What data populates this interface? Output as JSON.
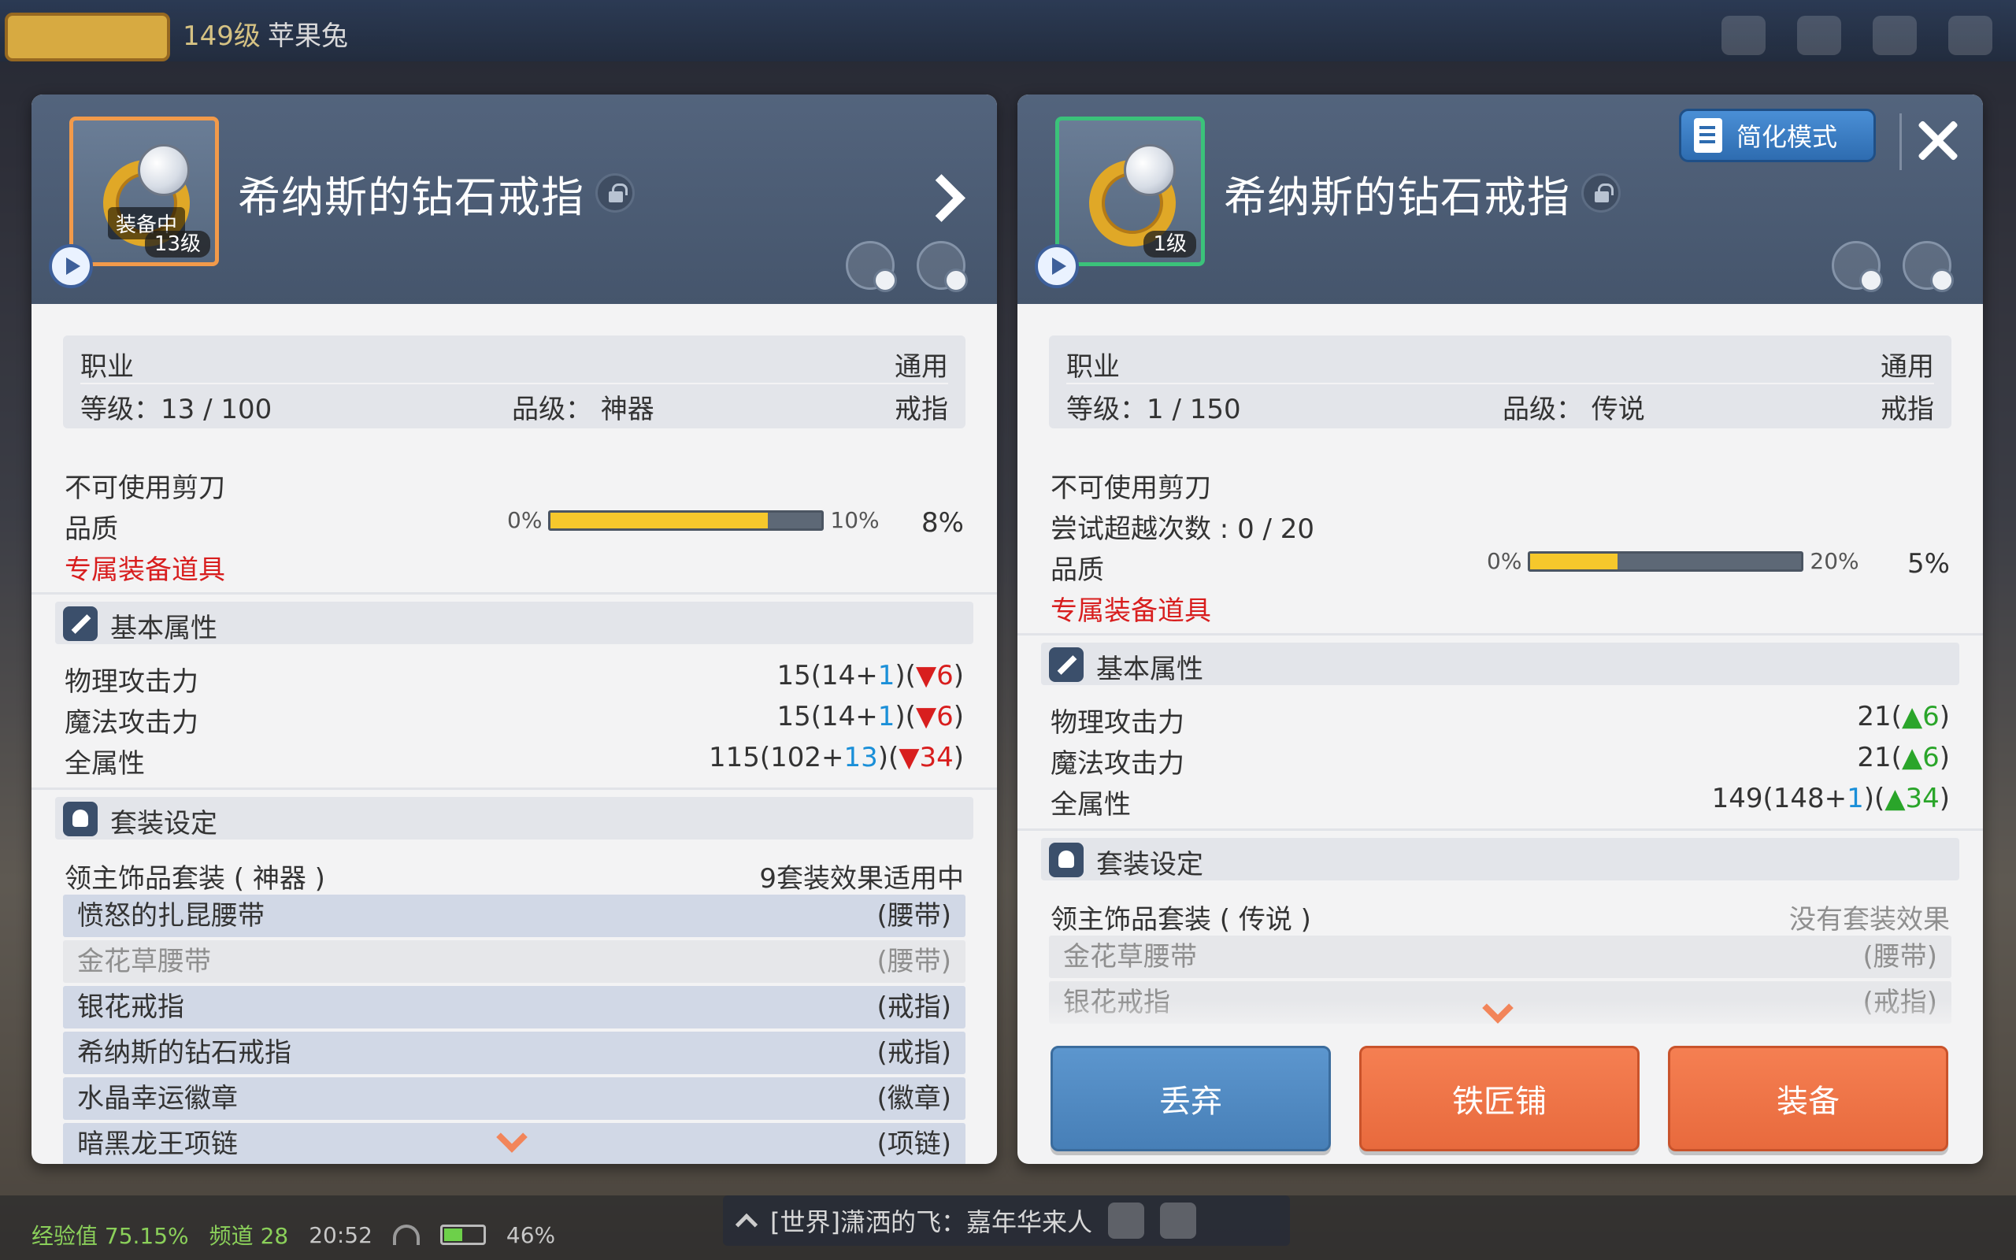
{
  "topbar": {
    "level": "149级",
    "player_name": "苹果兔"
  },
  "left_panel": {
    "item_name": "希纳斯的钻石戒指",
    "equipped_label": "装备中",
    "item_level": "13级",
    "info": {
      "job_label": "职业",
      "job_value": "通用",
      "level_label": "等级：13 / 100",
      "grade_label": "品级：  神器",
      "type_value": "戒指"
    },
    "no_scissors": "不可使用剪刀",
    "quality": {
      "label": "品质",
      "min": "0%",
      "max": "10%",
      "value": "8%",
      "fill_fraction": 0.8
    },
    "exclusive": "专属装备道具",
    "basic_section": "基本属性",
    "stats": [
      {
        "label": "物理攻击力",
        "base": "15(14+",
        "bonus": "1",
        "mid": ")(",
        "diff": "▼6",
        "end": ")"
      },
      {
        "label": "魔法攻击力",
        "base": "15(14+",
        "bonus": "1",
        "mid": ")(",
        "diff": "▼6",
        "end": ")"
      },
      {
        "label": "全属性",
        "base": "115(102+",
        "bonus": "13",
        "mid": ")(",
        "diff": "▼34",
        "end": ")"
      }
    ],
    "set_section": "套装设定",
    "set_name": "领主饰品套装 ( 神器 )",
    "set_status": "9套装效果适用中",
    "set_items": [
      {
        "name": "愤怒的扎昆腰带",
        "slot": "(腰带)"
      },
      {
        "name": "金花草腰带",
        "slot": "(腰带)"
      },
      {
        "name": "银花戒指",
        "slot": "(戒指)"
      },
      {
        "name": "希纳斯的钻石戒指",
        "slot": "(戒指)"
      },
      {
        "name": "水晶幸运徽章",
        "slot": "(徽章)"
      },
      {
        "name": "暗黑龙王项链",
        "slot": "(项链)"
      }
    ]
  },
  "right_panel": {
    "item_name": "希纳斯的钻石戒指",
    "item_level": "1级",
    "mode_button": "简化模式",
    "info": {
      "job_label": "职业",
      "job_value": "通用",
      "level_label": "等级：1 / 150",
      "grade_label": "品级：  传说",
      "type_value": "戒指"
    },
    "no_scissors": "不可使用剪刀",
    "transcend": "尝试超越次数 : 0 / 20",
    "quality": {
      "label": "品质",
      "min": "0%",
      "max": "20%",
      "value": "5%",
      "fill_fraction": 0.32
    },
    "exclusive": "专属装备道具",
    "basic_section": "基本属性",
    "stats": [
      {
        "label": "物理攻击力",
        "value": "21(",
        "diff": "▲6",
        "end": ")"
      },
      {
        "label": "魔法攻击力",
        "value": "21(",
        "diff": "▲6",
        "end": ")"
      },
      {
        "label": "全属性",
        "value": "149(148+",
        "bonus": "1",
        "mid": ")(",
        "diff": "▲34",
        "end": ")"
      }
    ],
    "set_section": "套装设定",
    "set_name": "领主饰品套装 ( 传说 )",
    "set_status": "没有套装效果",
    "set_items": [
      {
        "name": "金花草腰带",
        "slot": "(腰带)"
      },
      {
        "name": "银花戒指",
        "slot": "(戒指)"
      }
    ],
    "buttons": {
      "discard": "丢弃",
      "smithy": "铁匠铺",
      "equip": "装备"
    }
  },
  "bottom": {
    "exp": "经验值 75.15%",
    "channel": "频道 28",
    "time": "20:52",
    "battery": "46%",
    "chat": "[世界]潇洒的飞：嘉年华来人"
  }
}
